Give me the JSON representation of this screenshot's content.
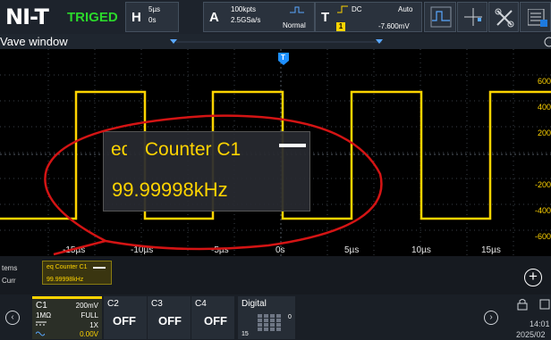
{
  "topbar": {
    "logo": "NI-T",
    "trigger_state": "TRIGED",
    "horizontal": {
      "letter": "H",
      "timebase": "5µs",
      "position": "0s"
    },
    "acquire": {
      "letter": "A",
      "memory": "100kpts",
      "sample_rate": "2.5GSa/s",
      "mode": "Normal"
    },
    "trigger": {
      "letter": "T",
      "coupling": "DC",
      "source": "1",
      "sweep": "Auto",
      "level": "-7.600mV"
    }
  },
  "wave_header": {
    "title": "Vave window"
  },
  "plot": {
    "trigger_marker": "T",
    "right_labels": [
      "600",
      "400",
      "200",
      "-200",
      "-400",
      "-600"
    ],
    "x_labels": [
      "-15µs",
      "-10µs",
      "-5µs",
      "0s",
      "5µs",
      "10µs",
      "15µs"
    ],
    "trace_color": "#ffd400"
  },
  "counter_overlay": {
    "title_prefix": "eq",
    "title": "Counter C1",
    "value": "99.99998kHz"
  },
  "measure_strip": {
    "row1_label": "tems",
    "row2_label": "Curr",
    "card_title": "eq  Counter C1",
    "card_value": "99.99998kHz"
  },
  "bottombar": {
    "left_arrow": "‹",
    "right_arrow": "›",
    "ch1": {
      "name": "C1",
      "scale": "200mV",
      "impedance": "1MΩ",
      "bandwidth": "FULL",
      "probe": "1X",
      "offset": "0.00V"
    },
    "ch2": {
      "name": "C2",
      "state": "OFF"
    },
    "ch3": {
      "name": "C3",
      "state": "OFF"
    },
    "ch4": {
      "name": "C4",
      "state": "OFF"
    },
    "digital": {
      "name": "Digital",
      "top_index": "0",
      "bottom_index": "15"
    },
    "clock_time": "14:01",
    "clock_date": "2025/02"
  }
}
